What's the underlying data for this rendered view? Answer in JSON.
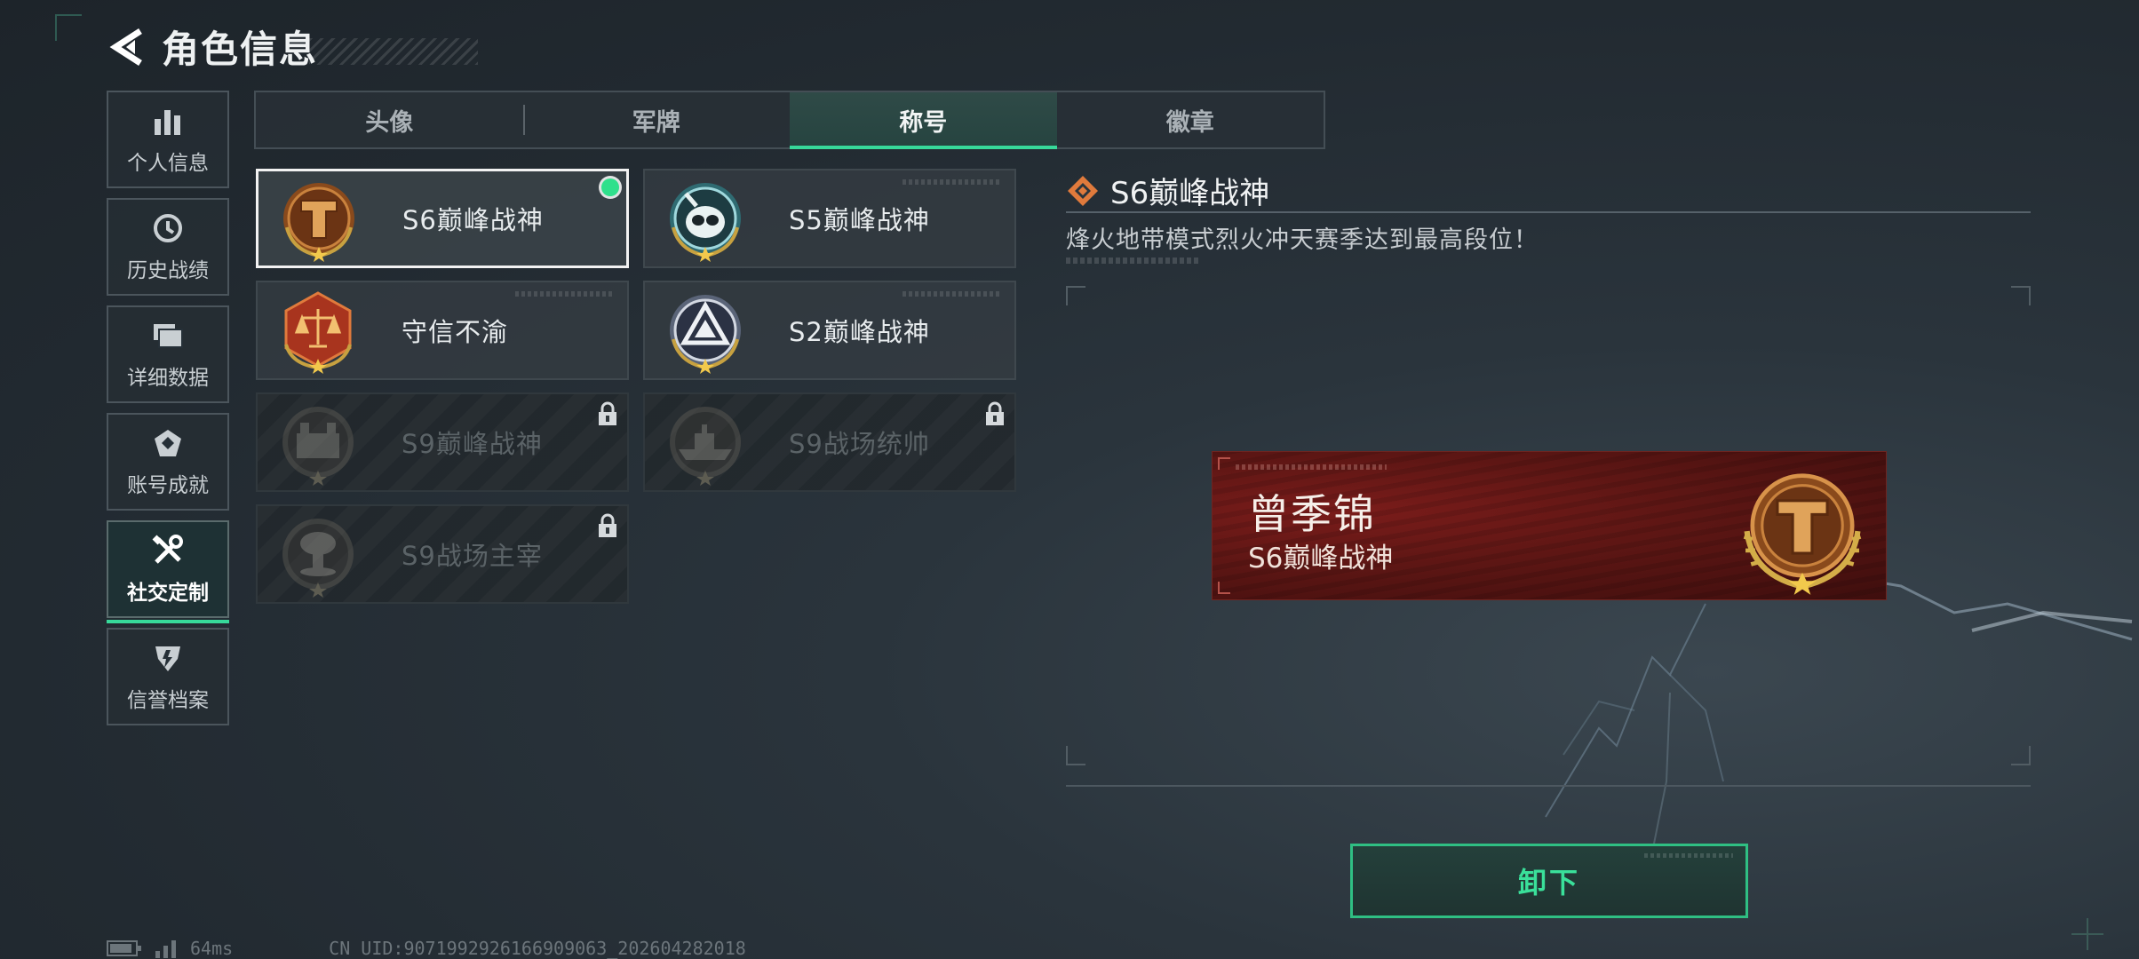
{
  "header": {
    "title": "角色信息"
  },
  "sidenav": {
    "items": [
      {
        "label": "个人信息",
        "icon": "bar-chart-icon"
      },
      {
        "label": "历史战绩",
        "icon": "clock-icon"
      },
      {
        "label": "详细数据",
        "icon": "folder-icon"
      },
      {
        "label": "账号成就",
        "icon": "achievement-icon"
      },
      {
        "label": "社交定制",
        "icon": "tools-icon",
        "active": true
      },
      {
        "label": "信誉档案",
        "icon": "shield-icon"
      }
    ]
  },
  "tabs": [
    {
      "label": "头像"
    },
    {
      "label": "军牌"
    },
    {
      "label": "称号",
      "active": true
    },
    {
      "label": "徽章"
    }
  ],
  "titles": [
    {
      "label": "S6巅峰战神",
      "icon": "bronze-t-medal-icon",
      "selected": true,
      "equipped": true,
      "locked": false
    },
    {
      "label": "S5巅峰战神",
      "icon": "skull-diver-medal-icon",
      "locked": false
    },
    {
      "label": "守信不渝",
      "icon": "scales-medal-icon",
      "locked": false
    },
    {
      "label": "S2巅峰战神",
      "icon": "triangle-silver-medal-icon",
      "locked": false
    },
    {
      "label": "S9巅峰战神",
      "icon": "fortress-medal-icon",
      "locked": true
    },
    {
      "label": "S9战场统帅",
      "icon": "warship-medal-icon",
      "locked": true
    },
    {
      "label": "S9战场主宰",
      "icon": "mushroom-cloud-medal-icon",
      "locked": true
    }
  ],
  "detail": {
    "name": "S6巅峰战神",
    "description": "烽火地带模式烈火冲天赛季达到最高段位！"
  },
  "nameplate": {
    "player_name": "曾季锦",
    "title": "S6巅峰战神"
  },
  "unequip_button": {
    "label": "卸下"
  },
  "status": {
    "ping": "64ms",
    "uid": "CN UID:9071992926166909063_202604282018"
  },
  "colors": {
    "accent": "#37d99a",
    "background": "#232b32",
    "nameplate_red": "#5d1614",
    "bronze": "#b56a2a"
  }
}
